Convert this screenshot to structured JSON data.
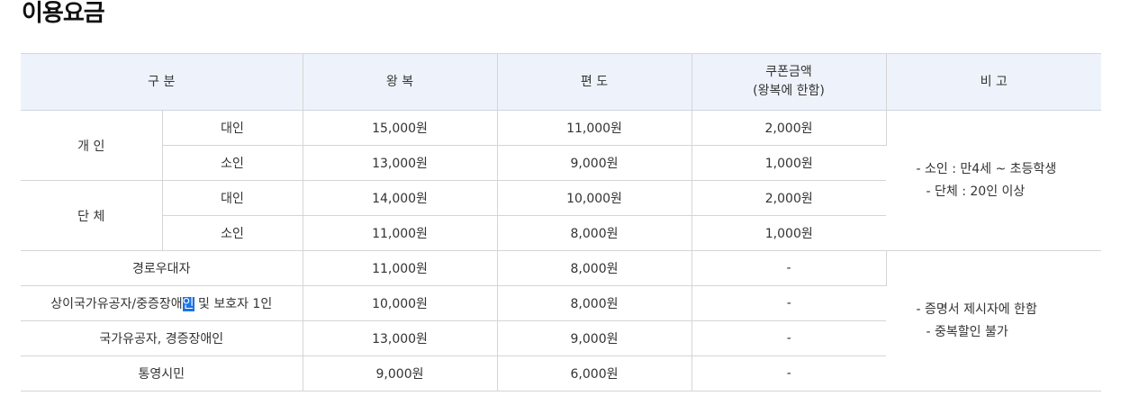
{
  "title": "이용요금",
  "headers": {
    "category": "구 분",
    "round": "왕 복",
    "oneway": "편 도",
    "coupon_line1": "쿠폰금액",
    "coupon_line2": "(왕복에 한함)",
    "note": "비 고"
  },
  "groups": {
    "individual": "개 인",
    "group": "단 체"
  },
  "rows": [
    {
      "label": "대인",
      "round": "15,000원",
      "oneway": "11,000원",
      "coupon": "2,000원"
    },
    {
      "label": "소인",
      "round": "13,000원",
      "oneway": "9,000원",
      "coupon": "1,000원"
    },
    {
      "label": "대인",
      "round": "14,000원",
      "oneway": "10,000원",
      "coupon": "2,000원"
    },
    {
      "label": "소인",
      "round": "11,000원",
      "oneway": "8,000원",
      "coupon": "1,000원"
    },
    {
      "label": "경로우대자",
      "round": "11,000원",
      "oneway": "8,000원",
      "coupon": "-"
    },
    {
      "label_pre": "상이국가유공자/중증장애",
      "label_hl": "인",
      "label_post": " 및 보호자 1인",
      "round": "10,000원",
      "oneway": "8,000원",
      "coupon": "-"
    },
    {
      "label": "국가유공자, 경증장애인",
      "round": "13,000원",
      "oneway": "9,000원",
      "coupon": "-"
    },
    {
      "label": "통영시민",
      "round": "9,000원",
      "oneway": "6,000원",
      "coupon": "-"
    }
  ],
  "notes": {
    "top_line1": "- 소인 : 만4세 ~ 초등학생",
    "top_line2": "- 단체 : 20인 이상",
    "bottom_line1": "- 증명서 제시자에 한함",
    "bottom_line2": "- 중복할인 불가"
  },
  "colors": {
    "header_bg": "#eef3fb",
    "border": "#d5d5d5",
    "selection": "#1a73e8"
  }
}
